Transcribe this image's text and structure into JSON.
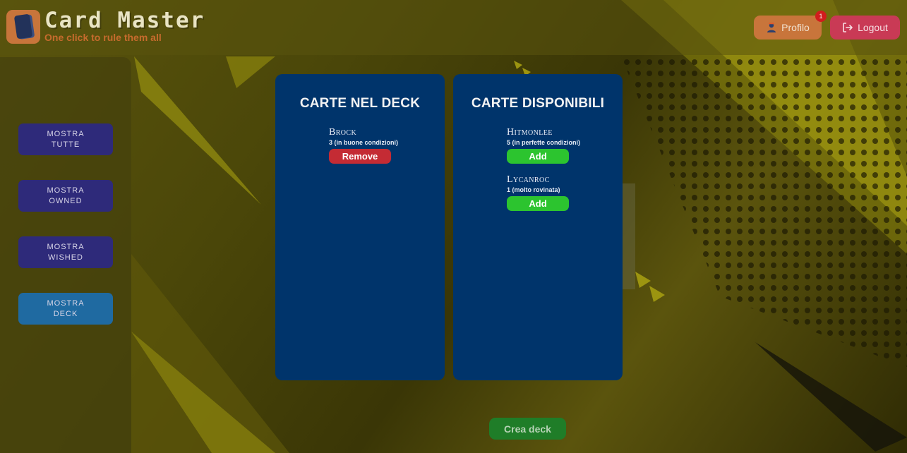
{
  "header": {
    "title": "Card Master",
    "subtitle": "One click to rule them all",
    "profile_label": "Profilo",
    "notification_count": "1",
    "logout_label": "Logout"
  },
  "sidebar": {
    "items": [
      {
        "label": "Mostra tutte",
        "active": false
      },
      {
        "label": "Mostra owned",
        "active": false
      },
      {
        "label": "Mostra wished",
        "active": false
      },
      {
        "label": "Mostra deck",
        "active": true
      }
    ]
  },
  "deck_panel": {
    "title": "CARTE NEL DECK",
    "cards": [
      {
        "name": "Brock",
        "condition": "3 (in buone condizioni)",
        "action": "Remove"
      }
    ]
  },
  "available_panel": {
    "title": "CARTE DISPONIBILI",
    "cards": [
      {
        "name": "Hitmonlee",
        "condition": "5 (in perfette condizioni)",
        "action": "Add"
      },
      {
        "name": "Lycanroc",
        "condition": "1 (molto rovinata)",
        "action": "Add"
      }
    ]
  },
  "create_deck_label": "Crea deck",
  "colors": {
    "panel": "#00346b",
    "remove": "#c42b34",
    "add": "#2cc42f",
    "crea": "#1f7d28",
    "sidebar_button": "#2e2a7a",
    "sidebar_button_active": "#1f6aa1",
    "profile": "#c8753b",
    "logout": "#c93a55"
  }
}
